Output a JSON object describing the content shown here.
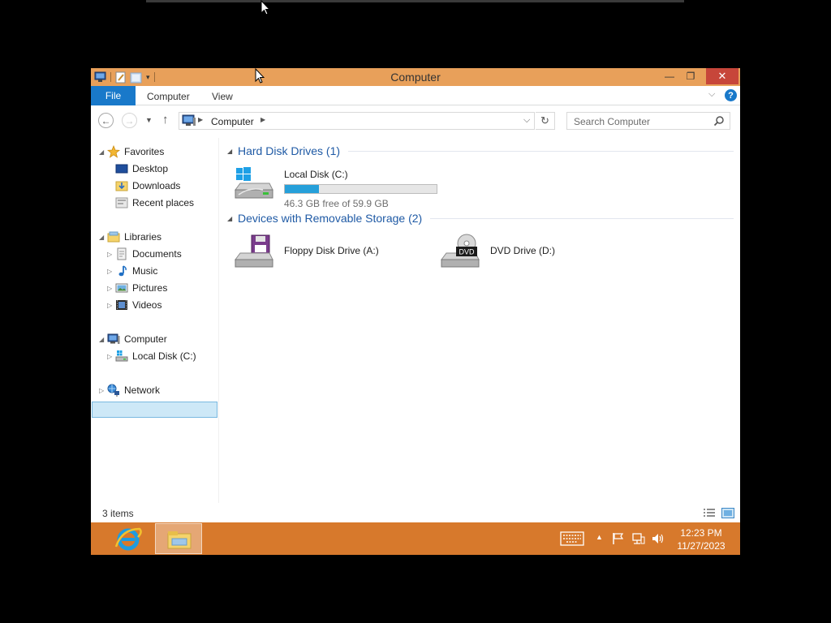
{
  "window": {
    "title": "Computer",
    "close_symbol": "✕",
    "min_symbol": "—",
    "max_symbol": "❐"
  },
  "ribbon": {
    "tabs": [
      "File",
      "Computer",
      "View"
    ],
    "help_label": "?"
  },
  "address": {
    "path": "Computer",
    "search_placeholder": "Search Computer"
  },
  "navpane": {
    "favorites": "Favorites",
    "favorites_items": [
      "Desktop",
      "Downloads",
      "Recent places"
    ],
    "libraries": "Libraries",
    "libraries_items": [
      "Documents",
      "Music",
      "Pictures",
      "Videos"
    ],
    "computer": "Computer",
    "computer_items": [
      "Local Disk (C:)"
    ],
    "network": "Network"
  },
  "content": {
    "groups": [
      {
        "title": "Hard Disk Drives (1)",
        "items": [
          {
            "name": "Local Disk (C:)",
            "free_text": "46.3 GB free of 59.9 GB",
            "used_fraction": 0.227
          }
        ]
      },
      {
        "title": "Devices with Removable Storage (2)",
        "items": [
          {
            "name": "Floppy Disk Drive (A:)"
          },
          {
            "name": "DVD Drive (D:)",
            "badge": "DVD"
          }
        ]
      }
    ]
  },
  "status": {
    "item_count": "3 items"
  },
  "taskbar": {
    "time": "12:23 PM",
    "date": "11/27/2023"
  },
  "colors": {
    "titlebar": "#e8a05a",
    "taskbar": "#d7792c",
    "accent": "#1979ca",
    "close": "#c7463a",
    "selection": "#cde8f7",
    "group_title": "#1f5aa5"
  }
}
